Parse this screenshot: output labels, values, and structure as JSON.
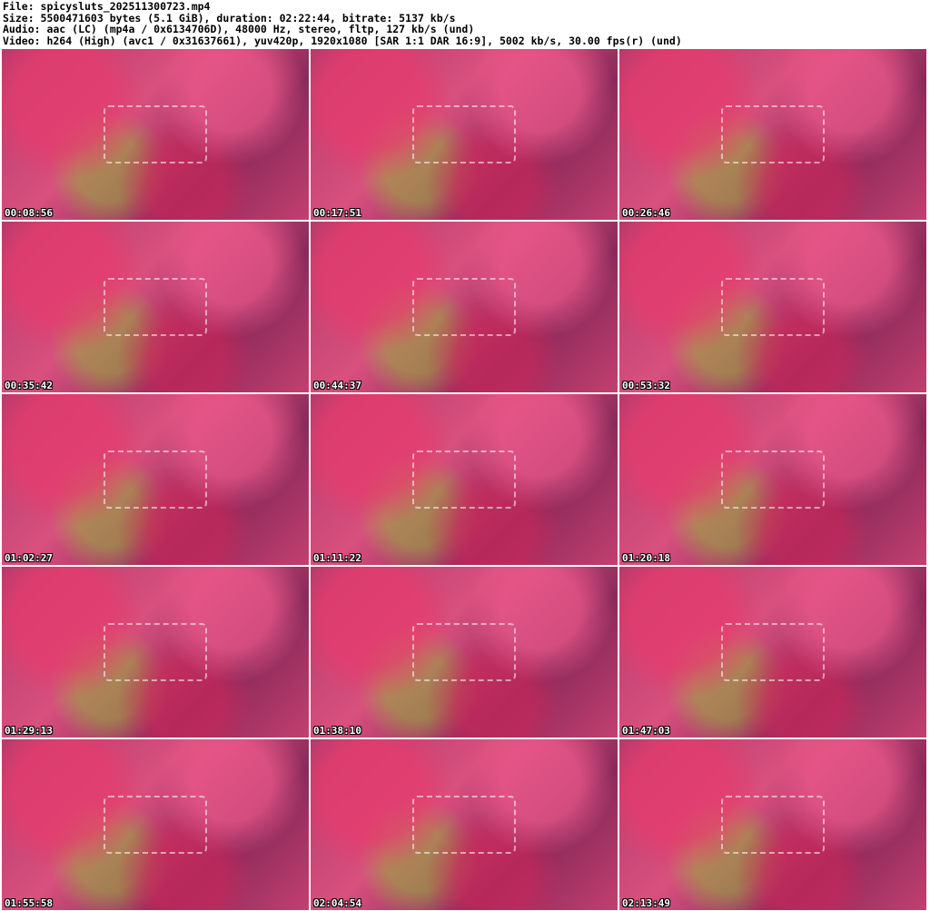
{
  "header": {
    "file": "File: spicysluts_202511300723.mp4",
    "size": "Size: 5500471603 bytes (5.1 GiB), duration: 02:22:44, bitrate: 5137 kb/s",
    "audio": "Audio: aac (LC) (mp4a / 0x6134706D), 48000 Hz, stereo, fltp, 127 kb/s (und)",
    "video": "Video: h264 (High) (avc1 / 0x31637661), yuv420p, 1920x1080 [SAR 1:1 DAR 16:9], 5002 kb/s, 30.00 fps(r) (und)"
  },
  "thumbnails": [
    {
      "timestamp": "00:08:56"
    },
    {
      "timestamp": "00:17:51"
    },
    {
      "timestamp": "00:26:46"
    },
    {
      "timestamp": "00:35:42"
    },
    {
      "timestamp": "00:44:37"
    },
    {
      "timestamp": "00:53:32"
    },
    {
      "timestamp": "01:02:27"
    },
    {
      "timestamp": "01:11:22"
    },
    {
      "timestamp": "01:20:18"
    },
    {
      "timestamp": "01:29:13"
    },
    {
      "timestamp": "01:38:10"
    },
    {
      "timestamp": "01:47:03"
    },
    {
      "timestamp": "01:55:58"
    },
    {
      "timestamp": "02:04:54"
    },
    {
      "timestamp": "02:13:49"
    }
  ]
}
